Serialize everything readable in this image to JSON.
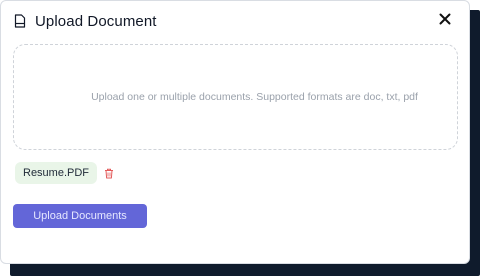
{
  "modal": {
    "title": "Upload Document",
    "icon": "document-icon",
    "close_icon": "close-icon"
  },
  "dropzone": {
    "text": "Upload one or multiple documents. Supported formats are doc, txt, pdf"
  },
  "files": [
    {
      "name": "Resume.PDF",
      "delete_icon": "trash-icon"
    }
  ],
  "actions": {
    "upload_label": "Upload Documents"
  },
  "colors": {
    "primary": "#6366d8",
    "chip_bg": "#e9f5e8",
    "delete": "#e35a5a",
    "backdrop": "#0f1b2c"
  }
}
